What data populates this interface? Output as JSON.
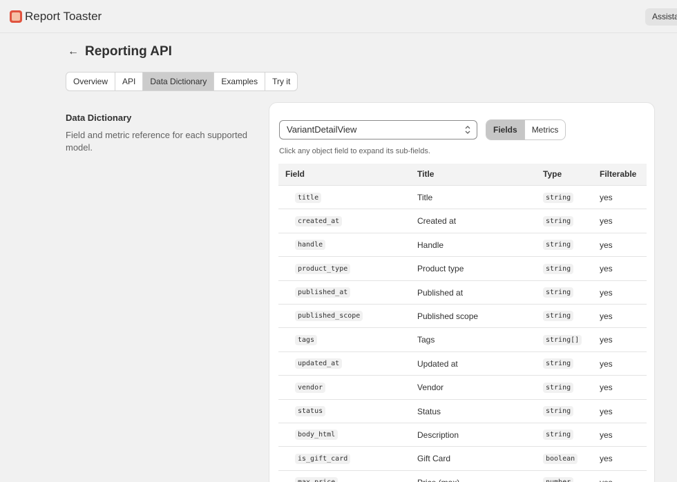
{
  "header": {
    "app_title": "Report Toaster",
    "assistant_label": "Assistant"
  },
  "page": {
    "back_symbol": "←",
    "title": "Reporting API"
  },
  "tabs": [
    {
      "label": "Overview",
      "active": false
    },
    {
      "label": "API",
      "active": false
    },
    {
      "label": "Data Dictionary",
      "active": true
    },
    {
      "label": "Examples",
      "active": false
    },
    {
      "label": "Try it",
      "active": false
    }
  ],
  "section": {
    "title": "Data Dictionary",
    "description": "Field and metric reference for each supported model."
  },
  "panel": {
    "model_select": "VariantDetailView",
    "view_toggle": [
      "Fields",
      "Metrics"
    ],
    "active_view": "Fields",
    "hint": "Click any object field to expand its sub-fields."
  },
  "table": {
    "headers": {
      "field": "Field",
      "title": "Title",
      "type": "Type",
      "filterable": "Filterable"
    },
    "rows": [
      {
        "field": "title",
        "title": "Title",
        "type": "string",
        "filterable": "yes"
      },
      {
        "field": "created_at",
        "title": "Created at",
        "type": "string",
        "filterable": "yes"
      },
      {
        "field": "handle",
        "title": "Handle",
        "type": "string",
        "filterable": "yes"
      },
      {
        "field": "product_type",
        "title": "Product type",
        "type": "string",
        "filterable": "yes"
      },
      {
        "field": "published_at",
        "title": "Published at",
        "type": "string",
        "filterable": "yes"
      },
      {
        "field": "published_scope",
        "title": "Published scope",
        "type": "string",
        "filterable": "yes"
      },
      {
        "field": "tags",
        "title": "Tags",
        "type": "string[]",
        "filterable": "yes"
      },
      {
        "field": "updated_at",
        "title": "Updated at",
        "type": "string",
        "filterable": "yes"
      },
      {
        "field": "vendor",
        "title": "Vendor",
        "type": "string",
        "filterable": "yes"
      },
      {
        "field": "status",
        "title": "Status",
        "type": "string",
        "filterable": "yes"
      },
      {
        "field": "body_html",
        "title": "Description",
        "type": "string",
        "filterable": "yes"
      },
      {
        "field": "is_gift_card",
        "title": "Gift Card",
        "type": "boolean",
        "filterable": "yes"
      },
      {
        "field": "max_price",
        "title": "Price (max)",
        "type": "number",
        "filterable": "yes"
      }
    ]
  },
  "colors": {
    "accent_active_tab": "#cccccc",
    "background": "#f1f1f1",
    "logo": "#e0533f"
  },
  "icons": {
    "logo": "report-toaster-logo-icon",
    "back": "arrow-left-icon",
    "select": "chevron-up-down-icon"
  }
}
